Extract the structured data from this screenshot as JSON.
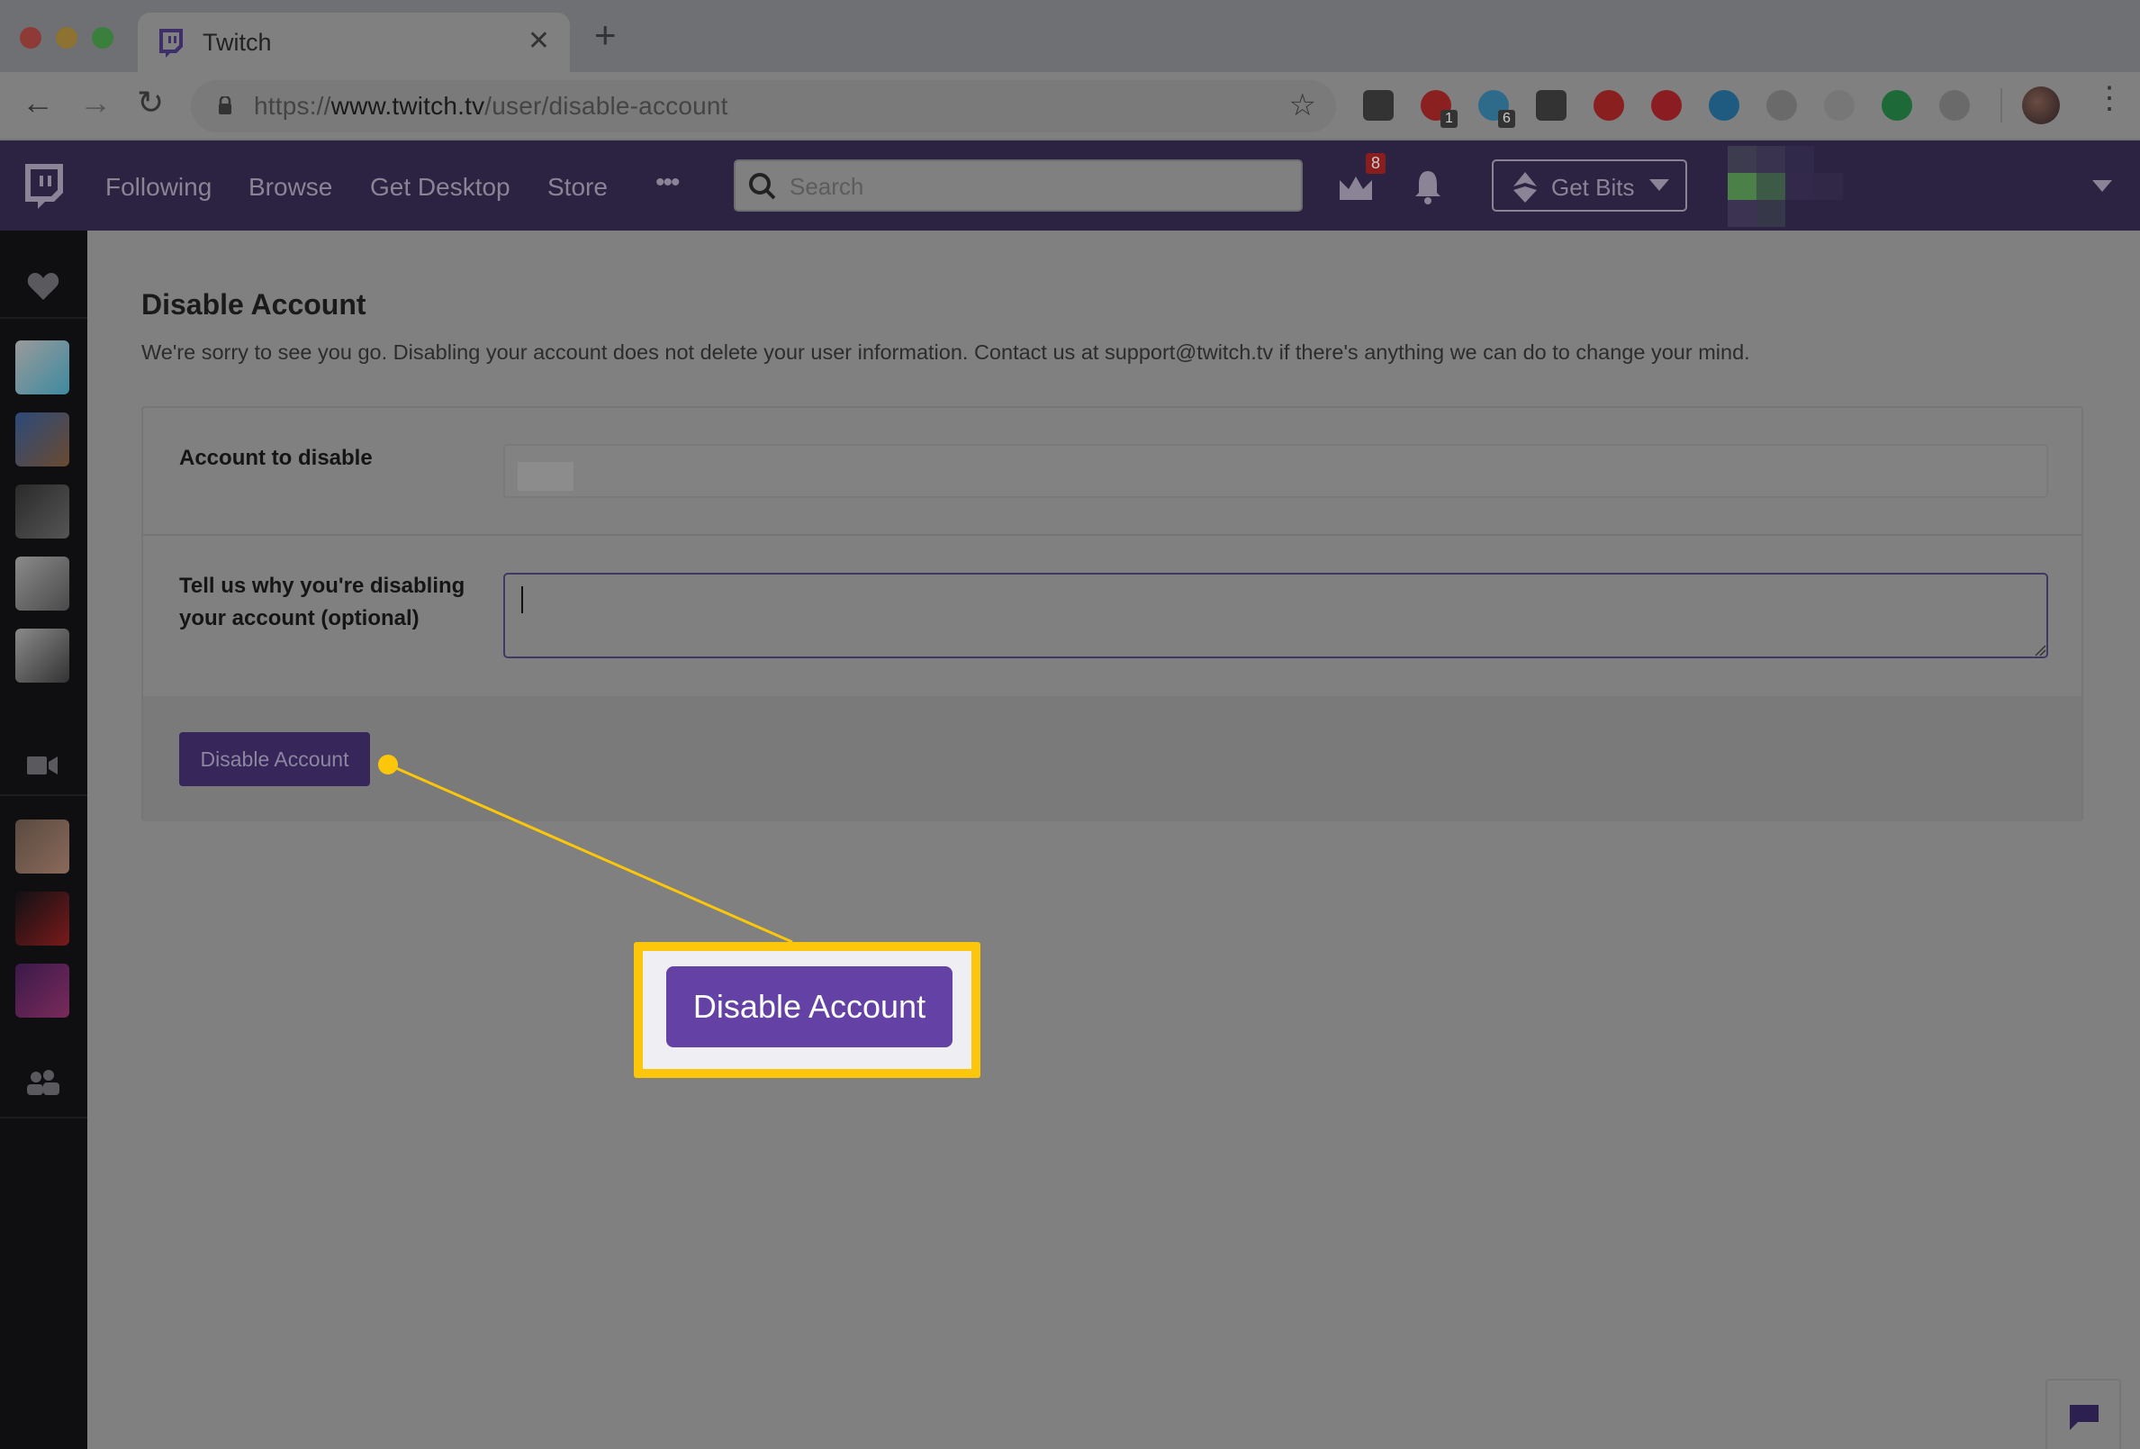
{
  "browser": {
    "tab_title": "Twitch",
    "url_scheme": "https://",
    "url_host": "www.twitch.tv",
    "url_path": "/user/disable-account",
    "extensions": [
      {
        "name": "pocket-icon",
        "color": "#333333"
      },
      {
        "name": "lastpass-icon",
        "color": "#8b2020",
        "badge": "1"
      },
      {
        "name": "ghostery-icon",
        "color": "#2e6a8a",
        "badge": "6"
      },
      {
        "name": "cast-icon",
        "color": "#333333"
      },
      {
        "name": "red-circle-extension-icon",
        "color": "#8a1f1f"
      },
      {
        "name": "pinterest-icon",
        "color": "#8a1c22"
      },
      {
        "name": "blue-ring-extension-icon",
        "color": "#1f5a80"
      },
      {
        "name": "feather-extension-icon",
        "color": "#6a6a6a"
      },
      {
        "name": "document-plus-extension-icon",
        "color": "#777777"
      },
      {
        "name": "hangouts-icon",
        "color": "#1d6a38"
      },
      {
        "name": "grey-circle-extension-icon",
        "color": "#6a6a6a"
      }
    ]
  },
  "topnav": {
    "links": [
      "Following",
      "Browse",
      "Get Desktop",
      "Store"
    ],
    "more_label": "•••",
    "search_placeholder": "Search",
    "crown_badge": "8",
    "get_bits_label": "Get Bits"
  },
  "sidebar": {
    "followed_channels": [
      {
        "name": "channel-1",
        "colors": [
          "#9a9a9a",
          "#3e8aa0"
        ]
      },
      {
        "name": "channel-2",
        "colors": [
          "#2c4a7a",
          "#6a4a30"
        ]
      },
      {
        "name": "channel-3-playstation",
        "colors": [
          "#2a2a2a",
          "#555555"
        ]
      },
      {
        "name": "channel-4",
        "colors": [
          "#8a8a8a",
          "#4a4a4a"
        ]
      },
      {
        "name": "channel-5",
        "colors": [
          "#8a8a8a",
          "#333333"
        ]
      }
    ],
    "recommended_channels": [
      {
        "name": "channel-6",
        "colors": [
          "#5a4a40",
          "#8a6a5a"
        ]
      },
      {
        "name": "channel-7-cizzorz",
        "colors": [
          "#101014",
          "#7a1a1a"
        ]
      },
      {
        "name": "channel-8",
        "colors": [
          "#3a1a4a",
          "#7a2a5a"
        ]
      }
    ]
  },
  "page": {
    "title": "Disable Account",
    "description": "We're sorry to see you go. Disabling your account does not delete your user information. Contact us at support@twitch.tv if there's anything we can do to change your mind.",
    "account_label": "Account to disable",
    "account_value": "",
    "reason_label": "Tell us why you're disabling your account (optional)",
    "reason_value": "",
    "submit_label": "Disable Account"
  },
  "callout": {
    "label": "Disable Account",
    "color": "#fcc70a"
  }
}
